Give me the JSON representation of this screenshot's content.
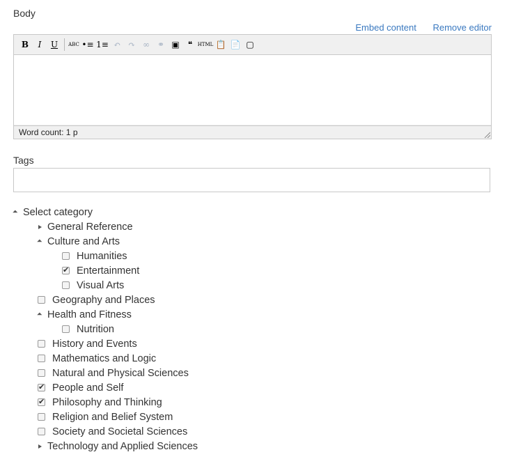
{
  "body": {
    "label": "Body",
    "links": {
      "embed": "Embed content",
      "remove": "Remove editor"
    },
    "toolbar": [
      {
        "name": "bold-button",
        "glyph": "B"
      },
      {
        "name": "italic-button",
        "glyph": "I"
      },
      {
        "name": "underline-button",
        "glyph": "U"
      },
      {
        "name": "spellcheck-button",
        "glyph": "ABC"
      },
      {
        "name": "bulleted-list-button",
        "glyph": "•≡"
      },
      {
        "name": "numbered-list-button",
        "glyph": "1≡"
      },
      {
        "name": "undo-button",
        "glyph": "↶"
      },
      {
        "name": "redo-button",
        "glyph": "↷"
      },
      {
        "name": "link-button",
        "glyph": "∞"
      },
      {
        "name": "unlink-button",
        "glyph": "⚭"
      },
      {
        "name": "image-button",
        "glyph": "▣"
      },
      {
        "name": "blockquote-button",
        "glyph": "❝"
      },
      {
        "name": "html-button",
        "glyph": "HTML"
      },
      {
        "name": "paste-text-button",
        "glyph": "📋"
      },
      {
        "name": "paste-word-button",
        "glyph": "📄"
      },
      {
        "name": "fullscreen-button",
        "glyph": "▢"
      }
    ],
    "status": "Word count: 1 p"
  },
  "tags": {
    "label": "Tags",
    "value": ""
  },
  "category": {
    "title": "Select category",
    "items": [
      {
        "label": "General Reference",
        "kind": "collapsed",
        "level": 1
      },
      {
        "label": "Culture and Arts",
        "kind": "expanded",
        "level": 1
      },
      {
        "label": "Humanities",
        "kind": "checkbox",
        "checked": false,
        "level": 2
      },
      {
        "label": "Entertainment",
        "kind": "checkbox",
        "checked": true,
        "level": 2
      },
      {
        "label": "Visual Arts",
        "kind": "checkbox",
        "checked": false,
        "level": 2
      },
      {
        "label": "Geography and Places",
        "kind": "checkbox",
        "checked": false,
        "level": 1
      },
      {
        "label": "Health and Fitness",
        "kind": "expanded",
        "level": 1
      },
      {
        "label": "Nutrition",
        "kind": "checkbox",
        "checked": false,
        "level": 2
      },
      {
        "label": "History and Events",
        "kind": "checkbox",
        "checked": false,
        "level": 1
      },
      {
        "label": "Mathematics and Logic",
        "kind": "checkbox",
        "checked": false,
        "level": 1
      },
      {
        "label": "Natural and Physical Sciences",
        "kind": "checkbox",
        "checked": false,
        "level": 1
      },
      {
        "label": "People and Self",
        "kind": "checkbox",
        "checked": true,
        "level": 1
      },
      {
        "label": "Philosophy and Thinking",
        "kind": "checkbox",
        "checked": true,
        "level": 1
      },
      {
        "label": "Religion and Belief System",
        "kind": "checkbox",
        "checked": false,
        "level": 1
      },
      {
        "label": "Society and Societal Sciences",
        "kind": "checkbox",
        "checked": false,
        "level": 1
      },
      {
        "label": "Technology and Applied Sciences",
        "kind": "collapsed",
        "level": 1
      }
    ]
  }
}
